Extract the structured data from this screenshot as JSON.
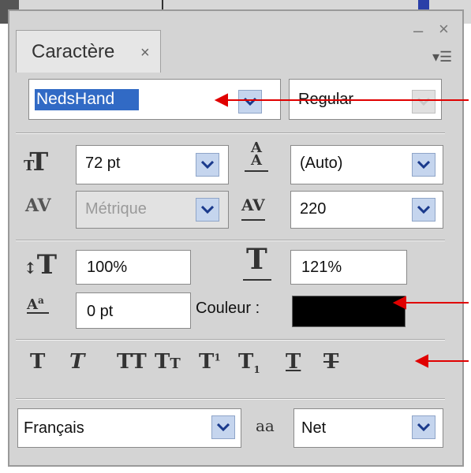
{
  "panel": {
    "tab_label": "Caractère",
    "tab_close": "×",
    "minimize": "–",
    "close": "×",
    "menu_icon": "▾☰"
  },
  "font": {
    "family": "NedsHand",
    "style": "Regular"
  },
  "metrics": {
    "font_size": "72 pt",
    "leading": "(Auto)",
    "kerning": "Métrique",
    "tracking": "220",
    "vertical_scale": "100%",
    "horizontal_scale": "121%",
    "baseline_shift": "0 pt",
    "color_label": "Couleur :",
    "color_value": "#000000"
  },
  "style_buttons": [
    "faux-bold",
    "faux-italic",
    "all-caps",
    "small-caps",
    "superscript",
    "subscript",
    "underline",
    "strikethrough"
  ],
  "language": {
    "value": "Français",
    "antialias_icon": "aa",
    "antialias": "Net"
  },
  "colors": {
    "panel_bg": "#d4d4d4",
    "dropdown_bg": "#c5d5ee",
    "selection": "#316ac5",
    "arrow": "#e00000"
  }
}
